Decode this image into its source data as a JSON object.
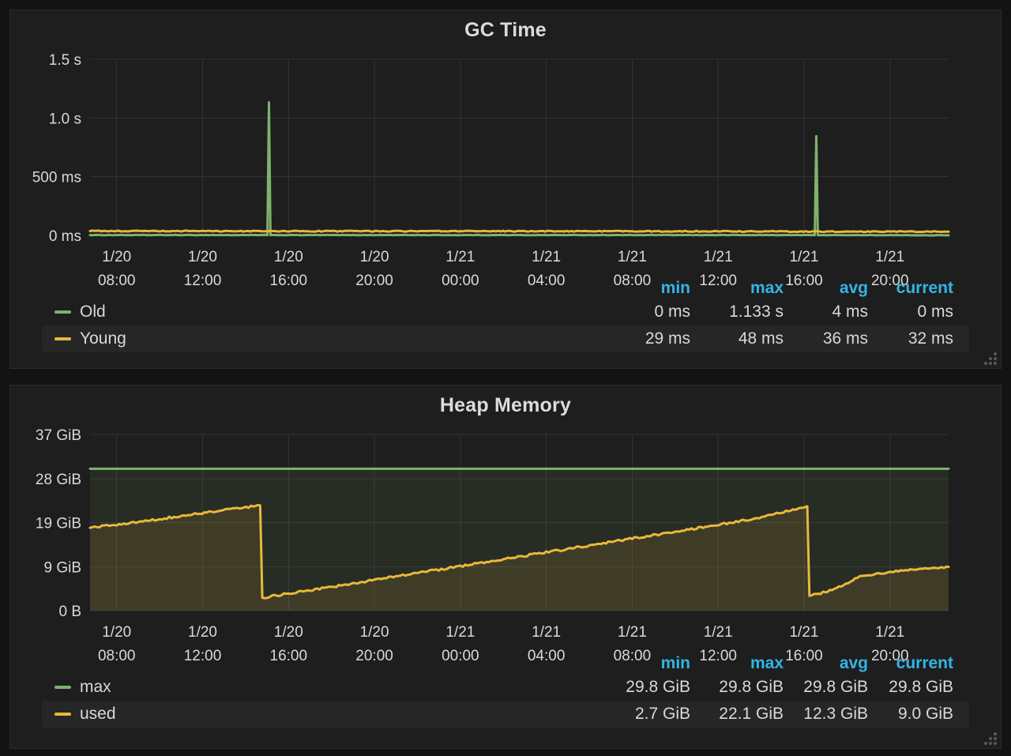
{
  "page": {
    "background": "#131313"
  },
  "colors": {
    "green": "#7eb26d",
    "yellow": "#eab839",
    "legend_header_blue": "#33b5e5",
    "grid": "#323232",
    "panel_bg": "#1e1e1e",
    "text": "#d8d9da"
  },
  "panels": [
    {
      "title": "GC Time",
      "legend": {
        "headers": [
          "min",
          "max",
          "avg",
          "current"
        ],
        "rows": [
          {
            "name": "Old",
            "color": "#7eb26d",
            "highlight": false,
            "values": [
              "0 ms",
              "1.133 s",
              "4 ms",
              "0 ms"
            ]
          },
          {
            "name": "Young",
            "color": "#eab839",
            "highlight": true,
            "values": [
              "29 ms",
              "48 ms",
              "36 ms",
              "32 ms"
            ]
          }
        ]
      },
      "chart_data": {
        "type": "line",
        "title": "GC Time",
        "y_unit": "ms",
        "y_range": [
          0,
          1500
        ],
        "x_range_hours": [
          6.76,
          46.73
        ],
        "grid": true,
        "legend_position": "bottom-table",
        "y_ticks": [
          {
            "v": 0,
            "label": "0 ms"
          },
          {
            "v": 500,
            "label": "500 ms"
          },
          {
            "v": 1000,
            "label": "1.0 s"
          },
          {
            "v": 1500,
            "label": "1.5 s"
          }
        ],
        "x_ticks": [
          {
            "t": 8,
            "date": "1/20",
            "time": "08:00"
          },
          {
            "t": 12,
            "date": "1/20",
            "time": "12:00"
          },
          {
            "t": 16,
            "date": "1/20",
            "time": "16:00"
          },
          {
            "t": 20,
            "date": "1/20",
            "time": "20:00"
          },
          {
            "t": 24,
            "date": "1/21",
            "time": "00:00"
          },
          {
            "t": 28,
            "date": "1/21",
            "time": "04:00"
          },
          {
            "t": 32,
            "date": "1/21",
            "time": "08:00"
          },
          {
            "t": 36,
            "date": "1/21",
            "time": "12:00"
          },
          {
            "t": 40,
            "date": "1/21",
            "time": "16:00"
          },
          {
            "t": 44,
            "date": "1/21",
            "time": "20:00"
          }
        ],
        "series": [
          {
            "name": "Old",
            "color": "#7eb26d",
            "noise": 1.5,
            "width": 3,
            "fill": null,
            "points": [
              [
                6.76,
                3
              ],
              [
                15.02,
                3
              ],
              [
                15.09,
                1133
              ],
              [
                15.16,
                3
              ],
              [
                40.5,
                3
              ],
              [
                40.57,
                845
              ],
              [
                40.64,
                3
              ],
              [
                46.73,
                1
              ]
            ],
            "stats": {
              "min": "0 ms",
              "max": "1.133 s",
              "avg": "4 ms",
              "current": "0 ms"
            }
          },
          {
            "name": "Young",
            "color": "#eab839",
            "noise": 4,
            "width": 3,
            "fill": null,
            "points": [
              [
                6.76,
                37
              ],
              [
                14,
                36
              ],
              [
                24,
                36
              ],
              [
                34,
                35
              ],
              [
                46.73,
                32
              ]
            ],
            "stats": {
              "min": "29 ms",
              "max": "48 ms",
              "avg": "36 ms",
              "current": "32 ms"
            }
          }
        ]
      }
    },
    {
      "title": "Heap Memory",
      "legend": {
        "headers": [
          "min",
          "max",
          "avg",
          "current"
        ],
        "rows": [
          {
            "name": "max",
            "color": "#7eb26d",
            "highlight": false,
            "values": [
              "29.8 GiB",
              "29.8 GiB",
              "29.8 GiB",
              "29.8 GiB"
            ]
          },
          {
            "name": "used",
            "color": "#eab839",
            "highlight": true,
            "values": [
              "2.7 GiB",
              "22.1 GiB",
              "12.3 GiB",
              "9.0 GiB"
            ]
          }
        ]
      },
      "chart_data": {
        "type": "line",
        "title": "Heap Memory",
        "y_unit": "GiB",
        "y_range": [
          0,
          37
        ],
        "x_range_hours": [
          6.76,
          46.73
        ],
        "grid": true,
        "legend_position": "bottom-table",
        "y_ticks": [
          {
            "v": 0,
            "label": "0 B"
          },
          {
            "v": 9.25,
            "label": "9 GiB"
          },
          {
            "v": 18.5,
            "label": "19 GiB"
          },
          {
            "v": 27.75,
            "label": "28 GiB"
          },
          {
            "v": 37,
            "label": "37 GiB"
          }
        ],
        "x_ticks": [
          {
            "t": 8,
            "date": "1/20",
            "time": "08:00"
          },
          {
            "t": 12,
            "date": "1/20",
            "time": "12:00"
          },
          {
            "t": 16,
            "date": "1/20",
            "time": "16:00"
          },
          {
            "t": 20,
            "date": "1/20",
            "time": "20:00"
          },
          {
            "t": 24,
            "date": "1/21",
            "time": "00:00"
          },
          {
            "t": 28,
            "date": "1/21",
            "time": "04:00"
          },
          {
            "t": 32,
            "date": "1/21",
            "time": "08:00"
          },
          {
            "t": 36,
            "date": "1/21",
            "time": "12:00"
          },
          {
            "t": 40,
            "date": "1/21",
            "time": "16:00"
          },
          {
            "t": 44,
            "date": "1/21",
            "time": "20:00"
          }
        ],
        "series": [
          {
            "name": "max",
            "color": "#7eb26d",
            "noise": 0,
            "width": 3,
            "fill": "rgba(126,178,109,0.10)",
            "points": [
              [
                6.76,
                29.8
              ],
              [
                46.73,
                29.8
              ]
            ],
            "stats": {
              "min": "29.8 GiB",
              "max": "29.8 GiB",
              "avg": "29.8 GiB",
              "current": "29.8 GiB"
            }
          },
          {
            "name": "used",
            "color": "#eab839",
            "noise": 0.22,
            "width": 3,
            "fill": "rgba(234,184,57,0.12)",
            "points": [
              [
                6.76,
                17.4
              ],
              [
                9,
                18.6
              ],
              [
                11,
                19.9
              ],
              [
                12.85,
                21.0
              ],
              [
                14.68,
                22.1
              ],
              [
                14.78,
                2.7
              ],
              [
                18,
                5.0
              ],
              [
                22,
                7.9
              ],
              [
                26,
                10.8
              ],
              [
                30,
                13.7
              ],
              [
                34,
                16.6
              ],
              [
                37.6,
                19.2
              ],
              [
                40.15,
                21.9
              ],
              [
                40.25,
                3.1
              ],
              [
                41.3,
                4.3
              ],
              [
                42.7,
                7.3
              ],
              [
                44.5,
                8.5
              ],
              [
                46.73,
                9.2
              ]
            ],
            "stats": {
              "min": "2.7 GiB",
              "max": "22.1 GiB",
              "avg": "12.3 GiB",
              "current": "9.0 GiB"
            }
          }
        ]
      }
    }
  ]
}
